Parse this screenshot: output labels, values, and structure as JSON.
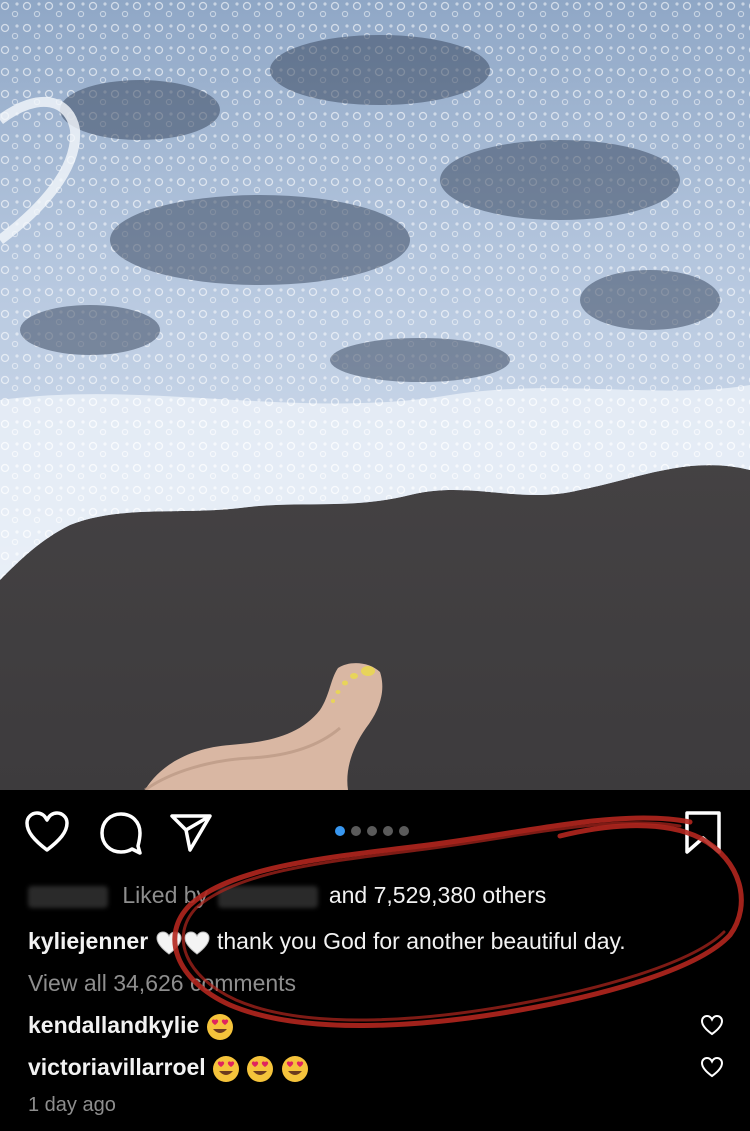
{
  "post": {
    "image_alt": "Foot on a sandy beach as a foamy wave washes in",
    "carousel": {
      "total": 5,
      "active": 1
    },
    "likes": {
      "prefix": "Liked by",
      "suffix": "and 7,529,380 others"
    },
    "caption": {
      "username": "kyliejenner",
      "emojis": [
        "white-heart",
        "white-heart"
      ],
      "text": "thank you God for another beautiful day."
    },
    "view_comments": "View all 34,626 comments",
    "comments": [
      {
        "username": "kendallandkylie",
        "emojis": [
          "heart-eyes"
        ]
      },
      {
        "username": "victoriavillarroel",
        "emojis": [
          "heart-eyes",
          "heart-eyes",
          "heart-eyes"
        ]
      }
    ],
    "timestamp": "1 day ago"
  },
  "icons": {
    "like": "heart-outline-icon",
    "comment": "comment-bubble-icon",
    "share": "paper-plane-icon",
    "save": "bookmark-icon"
  },
  "colors": {
    "background": "#000000",
    "text": "#f2f2f2",
    "muted": "#8e8e8e",
    "carousel_active": "#3897f0",
    "annotation": "#b3261e"
  }
}
